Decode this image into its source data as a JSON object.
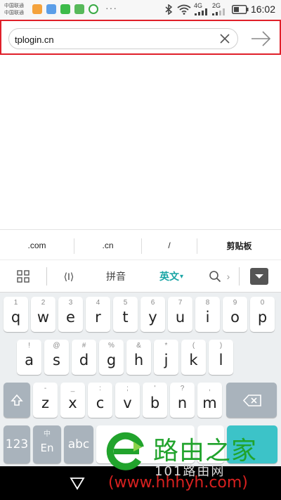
{
  "status_bar": {
    "carrier1": "中国联通",
    "carrier2": "中国联通",
    "overflow": "···",
    "net1": "4G",
    "net2": "2G",
    "time": "16:02"
  },
  "url_bar": {
    "url": "tplogin.cn"
  },
  "keyboard": {
    "suggestions": [
      ".com",
      ".cn",
      "/",
      "剪贴板"
    ],
    "tools": {
      "cursor": "⟨I⟩",
      "pinyin": "拼音",
      "english": "英文",
      "caret": "▾",
      "more": "›"
    },
    "row1": [
      {
        "hint": "1",
        "key": "q"
      },
      {
        "hint": "2",
        "key": "w"
      },
      {
        "hint": "3",
        "key": "e"
      },
      {
        "hint": "4",
        "key": "r"
      },
      {
        "hint": "5",
        "key": "t"
      },
      {
        "hint": "6",
        "key": "y"
      },
      {
        "hint": "7",
        "key": "u"
      },
      {
        "hint": "8",
        "key": "i"
      },
      {
        "hint": "9",
        "key": "o"
      },
      {
        "hint": "0",
        "key": "p"
      }
    ],
    "row2": [
      {
        "hint": "!",
        "key": "a"
      },
      {
        "hint": "@",
        "key": "s"
      },
      {
        "hint": "#",
        "key": "d"
      },
      {
        "hint": "%",
        "key": "g"
      },
      {
        "hint": "&",
        "key": "h"
      },
      {
        "hint": "*",
        "key": "j"
      },
      {
        "hint": "(",
        "key": "k"
      },
      {
        "hint": ")",
        "key": "l"
      }
    ],
    "row3": [
      {
        "hint": "-",
        "key": "z"
      },
      {
        "hint": "_",
        "key": "x"
      },
      {
        "hint": ":",
        "key": "c"
      },
      {
        "hint": ";",
        "key": "v"
      },
      {
        "hint": "'",
        "key": "b"
      },
      {
        "hint": "?",
        "key": "n"
      },
      {
        "hint": ",",
        "key": "m"
      }
    ],
    "row4": {
      "numbers": "123",
      "lang_top": "中",
      "lang_bottom": "En",
      "abc": "abc"
    }
  },
  "watermark": {
    "title": "路由之家",
    "subtitle": "101路由网",
    "url": "(www.hhhyh.com)"
  },
  "colors": {
    "highlight": "#e0202a",
    "accent": "#3cc3c8",
    "english_active": "#1aa5a5",
    "watermark_green": "#21a32c",
    "watermark_red": "#d8201f"
  }
}
